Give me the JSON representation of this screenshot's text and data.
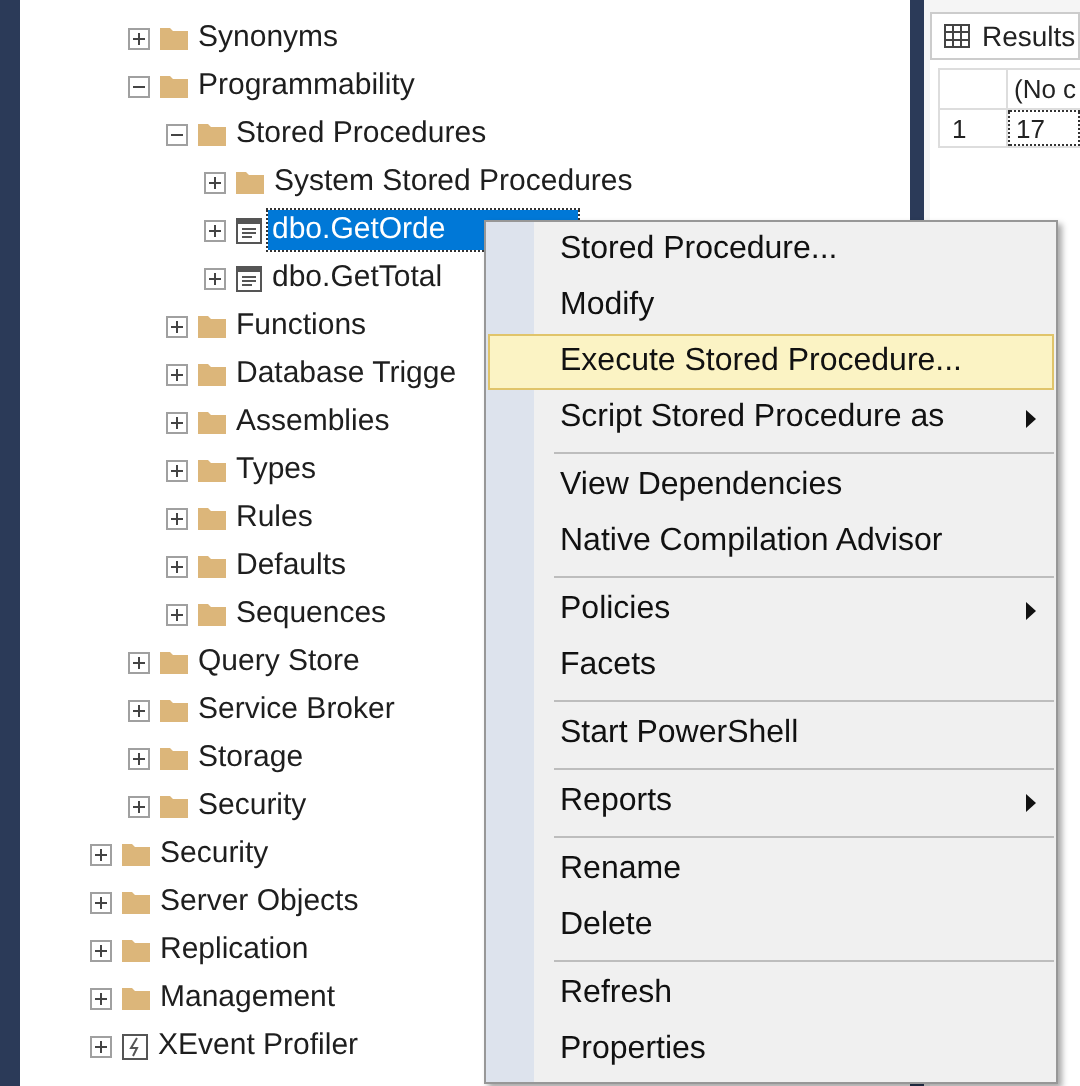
{
  "tree": {
    "database_items": [
      {
        "label": "Synonyms",
        "kind": "folder",
        "expanded": false
      },
      {
        "label": "Programmability",
        "kind": "folder",
        "expanded": true,
        "children": [
          {
            "label": "Stored Procedures",
            "kind": "folder",
            "expanded": true,
            "children": [
              {
                "label": "System Stored Procedures",
                "kind": "folder",
                "expanded": false,
                "selected": false
              },
              {
                "label": "dbo.GetOrde",
                "kind": "procedure",
                "expanded": false,
                "selected": true
              },
              {
                "label": "dbo.GetTotal",
                "kind": "procedure",
                "expanded": false,
                "selected": false
              }
            ]
          },
          {
            "label": "Functions",
            "kind": "folder",
            "expanded": false
          },
          {
            "label": "Database Trigge",
            "kind": "folder",
            "expanded": false
          },
          {
            "label": "Assemblies",
            "kind": "folder",
            "expanded": false
          },
          {
            "label": "Types",
            "kind": "folder",
            "expanded": false
          },
          {
            "label": "Rules",
            "kind": "folder",
            "expanded": false
          },
          {
            "label": "Defaults",
            "kind": "folder",
            "expanded": false
          },
          {
            "label": "Sequences",
            "kind": "folder",
            "expanded": false
          }
        ]
      },
      {
        "label": "Query Store",
        "kind": "folder",
        "expanded": false
      },
      {
        "label": "Service Broker",
        "kind": "folder",
        "expanded": false
      },
      {
        "label": "Storage",
        "kind": "folder",
        "expanded": false
      },
      {
        "label": "Security",
        "kind": "folder",
        "expanded": false
      }
    ],
    "server_items": [
      {
        "label": "Security",
        "kind": "folder",
        "expanded": false
      },
      {
        "label": "Server Objects",
        "kind": "folder",
        "expanded": false
      },
      {
        "label": "Replication",
        "kind": "folder",
        "expanded": false
      },
      {
        "label": "Management",
        "kind": "folder",
        "expanded": false
      },
      {
        "label": "XEvent Profiler",
        "kind": "profiler",
        "expanded": false
      }
    ]
  },
  "results": {
    "tab": "Results",
    "columns": [
      "(No c"
    ],
    "rows": [
      {
        "number": "1",
        "cells": [
          "17"
        ]
      }
    ]
  },
  "context_menu": {
    "groups": [
      [
        {
          "label": "Stored Procedure...",
          "selected": false,
          "submenu": false
        },
        {
          "label": "Modify",
          "selected": false,
          "submenu": false
        },
        {
          "label": "Execute Stored Procedure...",
          "selected": true,
          "submenu": false
        },
        {
          "label": "Script Stored Procedure as",
          "selected": false,
          "submenu": true
        }
      ],
      [
        {
          "label": "View Dependencies",
          "selected": false,
          "submenu": false
        },
        {
          "label": "Native Compilation Advisor",
          "selected": false,
          "submenu": false
        }
      ],
      [
        {
          "label": "Policies",
          "selected": false,
          "submenu": true
        },
        {
          "label": "Facets",
          "selected": false,
          "submenu": false
        }
      ],
      [
        {
          "label": "Start PowerShell",
          "selected": false,
          "submenu": false
        }
      ],
      [
        {
          "label": "Reports",
          "selected": false,
          "submenu": true
        }
      ],
      [
        {
          "label": "Rename",
          "selected": false,
          "submenu": false
        },
        {
          "label": "Delete",
          "selected": false,
          "submenu": false
        }
      ],
      [
        {
          "label": "Refresh",
          "selected": false,
          "submenu": false
        },
        {
          "label": "Properties",
          "selected": false,
          "submenu": false
        }
      ]
    ]
  }
}
